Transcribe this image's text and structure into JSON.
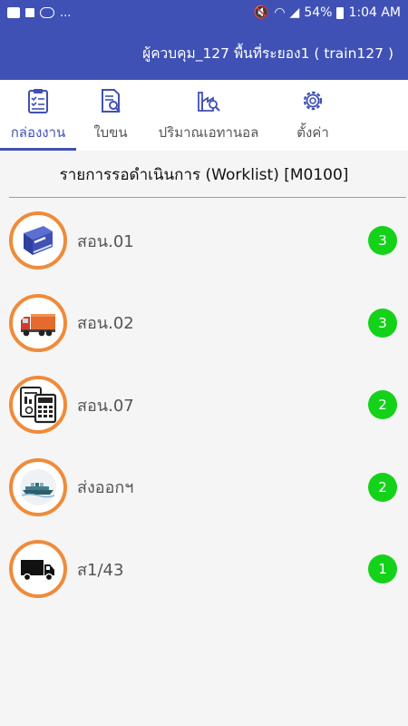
{
  "status_bar": {
    "left_text": "...",
    "battery": "54%",
    "time": "1:04 AM"
  },
  "app_bar": {
    "title": "ผู้ควบคุม_127 พื้นที่ระยอง1 ( train127 )"
  },
  "tabs": [
    {
      "label": "กล่องงาน",
      "icon": "clipboard-check-icon",
      "active": true
    },
    {
      "label": "ใบขน",
      "icon": "document-search-icon",
      "active": false
    },
    {
      "label": "ปริมาณเอทานอล",
      "icon": "factory-search-icon",
      "active": false
    },
    {
      "label": "ตั้งค่า",
      "icon": "gear-icon",
      "active": false
    }
  ],
  "worklist": {
    "title": "รายการรอดำเนินการ (Worklist) [M0100]",
    "items": [
      {
        "label": "สอน.01",
        "icon": "book-icon",
        "count": "3"
      },
      {
        "label": "สอน.02",
        "icon": "truck-icon",
        "count": "3"
      },
      {
        "label": "สอน.07",
        "icon": "calculator-report-icon",
        "count": "2"
      },
      {
        "label": "ส่งออกฯ",
        "icon": "ship-icon",
        "count": "2"
      },
      {
        "label": "ส1/43",
        "icon": "truck-black-icon",
        "count": "1"
      }
    ]
  },
  "colors": {
    "primary": "#3f51b5",
    "avatar_ring": "#ef8b3b",
    "badge": "#14d21a"
  }
}
